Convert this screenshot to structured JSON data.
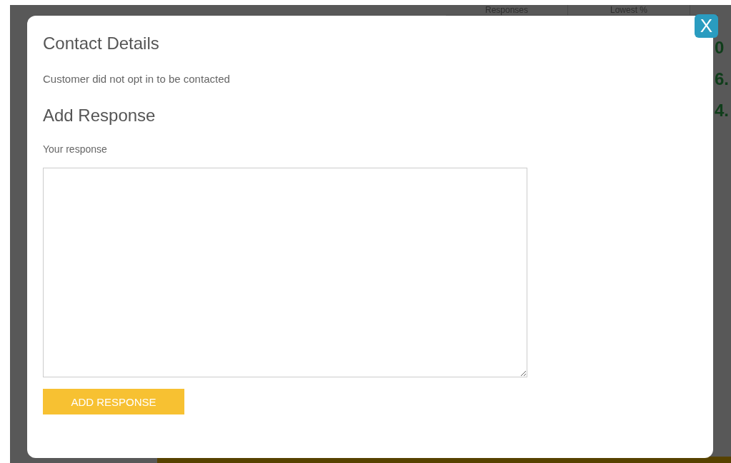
{
  "background": {
    "header_cells": [
      "Responses",
      "Lowest %"
    ],
    "scores": [
      "0",
      "6.",
      "4."
    ]
  },
  "modal": {
    "close": "X",
    "contact": {
      "title": "Contact Details",
      "text": "Customer did not opt in to be contacted"
    },
    "response": {
      "title": "Add Response",
      "label": "Your response",
      "button": "ADD RESPONSE"
    }
  }
}
